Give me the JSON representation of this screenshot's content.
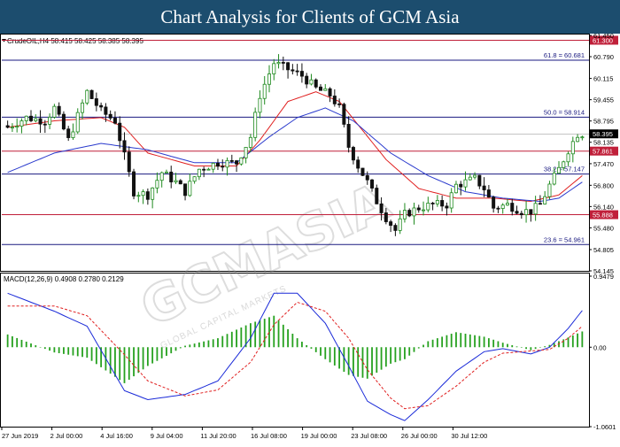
{
  "header": {
    "title": "Chart Analysis for Clients of GCM Asia"
  },
  "chart_data": {
    "type": "candlestick",
    "symbol_info": "CrudeOIL,H4  58.415 58.425 58.385 58.395",
    "watermark": "GCMASIA",
    "watermark_sub": "GLOBAL CAPITAL MARKETS",
    "ylim": [
      54.145,
      61.45
    ],
    "y_ticks": [
      "61.450",
      "60.790",
      "60.115",
      "59.455",
      "58.795",
      "58.135",
      "57.470",
      "56.800",
      "56.140",
      "55.480",
      "54.805",
      "54.145"
    ],
    "x_ticks": [
      "27 Jun 2019",
      "2 Jul 00:00",
      "4 Jul 16:00",
      "9 Jul 04:00",
      "11 Jul 20:00",
      "16 Jul 08:00",
      "19 Jul 00:00",
      "23 Jul 08:00",
      "26 Jul 00:00",
      "30 Jul 12:00"
    ],
    "current_price": {
      "value": 58.395,
      "label": "58.395",
      "color": "#000000"
    },
    "horizontal_lines": [
      {
        "value": 61.3,
        "label": "61.300",
        "color": "#c0203a",
        "tag": ""
      },
      {
        "value": 60.681,
        "label": "",
        "color": "#1a1a80",
        "tag": "61.8 = 60.681"
      },
      {
        "value": 58.914,
        "label": "",
        "color": "#1a1a80",
        "tag": "50.0 = 58.914"
      },
      {
        "value": 57.861,
        "label": "57.861",
        "color": "#c0203a",
        "tag": ""
      },
      {
        "value": 57.147,
        "label": "",
        "color": "#1a1a80",
        "tag": "38.2 = 57.147"
      },
      {
        "value": 55.888,
        "label": "55.888",
        "color": "#c0203a",
        "tag": ""
      },
      {
        "value": 54.961,
        "label": "",
        "color": "#1a1a80",
        "tag": "23.6 = 54.961"
      }
    ],
    "anchors": [
      [
        0,
        58.6
      ],
      [
        4,
        58.9
      ],
      [
        8,
        58.8
      ],
      [
        10,
        59.2
      ],
      [
        13,
        58.2
      ],
      [
        17,
        59.7
      ],
      [
        20,
        59.1
      ],
      [
        23,
        58.8
      ],
      [
        25,
        57.7
      ],
      [
        27,
        56.6
      ],
      [
        30,
        56.5
      ],
      [
        33,
        57.2
      ],
      [
        36,
        56.9
      ],
      [
        38,
        56.6
      ],
      [
        41,
        57.3
      ],
      [
        45,
        57.5
      ],
      [
        49,
        57.5
      ],
      [
        52,
        58.3
      ],
      [
        54,
        59.6
      ],
      [
        57,
        60.6
      ],
      [
        60,
        60.4
      ],
      [
        63,
        60.2
      ],
      [
        66,
        59.8
      ],
      [
        69,
        59.6
      ],
      [
        71,
        59.2
      ],
      [
        73,
        58.0
      ],
      [
        75,
        57.4
      ],
      [
        77,
        56.9
      ],
      [
        79,
        56.3
      ],
      [
        81,
        55.8
      ],
      [
        83,
        55.4
      ],
      [
        85,
        55.9
      ],
      [
        88,
        56.1
      ],
      [
        91,
        56.2
      ],
      [
        94,
        56.2
      ],
      [
        96,
        56.8
      ],
      [
        98,
        56.9
      ],
      [
        100,
        57.0
      ],
      [
        102,
        56.7
      ],
      [
        104,
        56.1
      ],
      [
        107,
        56.2
      ],
      [
        110,
        56.0
      ],
      [
        112,
        56.0
      ],
      [
        114,
        56.2
      ],
      [
        116,
        56.8
      ],
      [
        118,
        57.3
      ],
      [
        120,
        57.9
      ],
      [
        122,
        58.4
      ],
      [
        123,
        58.4
      ]
    ],
    "sma_red_anchors": [
      [
        0,
        58.6
      ],
      [
        10,
        58.8
      ],
      [
        20,
        58.9
      ],
      [
        25,
        58.6
      ],
      [
        30,
        57.8
      ],
      [
        40,
        57.4
      ],
      [
        49,
        57.4
      ],
      [
        54,
        58.2
      ],
      [
        60,
        59.4
      ],
      [
        66,
        59.7
      ],
      [
        71,
        59.4
      ],
      [
        76,
        58.5
      ],
      [
        81,
        57.6
      ],
      [
        88,
        56.7
      ],
      [
        96,
        56.4
      ],
      [
        104,
        56.4
      ],
      [
        112,
        56.3
      ],
      [
        118,
        56.5
      ],
      [
        123,
        57.1
      ]
    ],
    "sma_blue_anchors": [
      [
        0,
        57.2
      ],
      [
        10,
        57.8
      ],
      [
        20,
        58.1
      ],
      [
        30,
        57.9
      ],
      [
        40,
        57.5
      ],
      [
        49,
        57.5
      ],
      [
        56,
        58.3
      ],
      [
        62,
        58.9
      ],
      [
        68,
        59.2
      ],
      [
        74,
        58.8
      ],
      [
        82,
        57.8
      ],
      [
        90,
        57.1
      ],
      [
        98,
        56.6
      ],
      [
        106,
        56.4
      ],
      [
        114,
        56.3
      ],
      [
        118,
        56.4
      ],
      [
        123,
        56.9
      ]
    ],
    "macd": {
      "label": "MACD(12,26,9) 0.4908 0.2780 0.2129",
      "ylim": [
        -1.0601,
        0.9479
      ],
      "y_ticks": [
        "0.9479",
        "0.00",
        "-1.0601"
      ],
      "macd_anchors": [
        [
          0,
          0.72
        ],
        [
          10,
          0.48
        ],
        [
          17,
          0.28
        ],
        [
          25,
          -0.58
        ],
        [
          30,
          -0.7
        ],
        [
          38,
          -0.63
        ],
        [
          45,
          -0.45
        ],
        [
          52,
          0.12
        ],
        [
          57,
          0.72
        ],
        [
          62,
          0.72
        ],
        [
          68,
          0.32
        ],
        [
          73,
          -0.25
        ],
        [
          77,
          -0.72
        ],
        [
          82,
          -0.9
        ],
        [
          85,
          -0.98
        ],
        [
          90,
          -0.7
        ],
        [
          96,
          -0.32
        ],
        [
          102,
          -0.06
        ],
        [
          106,
          -0.02
        ],
        [
          112,
          -0.09
        ],
        [
          116,
          0.0
        ],
        [
          120,
          0.25
        ],
        [
          123,
          0.49
        ]
      ],
      "signal_anchors": [
        [
          0,
          0.55
        ],
        [
          10,
          0.55
        ],
        [
          17,
          0.42
        ],
        [
          25,
          -0.1
        ],
        [
          30,
          -0.45
        ],
        [
          38,
          -0.65
        ],
        [
          45,
          -0.57
        ],
        [
          52,
          -0.2
        ],
        [
          57,
          0.3
        ],
        [
          62,
          0.6
        ],
        [
          68,
          0.48
        ],
        [
          73,
          0.12
        ],
        [
          77,
          -0.3
        ],
        [
          82,
          -0.68
        ],
        [
          85,
          -0.82
        ],
        [
          90,
          -0.78
        ],
        [
          96,
          -0.52
        ],
        [
          102,
          -0.2
        ],
        [
          106,
          -0.08
        ],
        [
          112,
          -0.05
        ],
        [
          116,
          -0.03
        ],
        [
          120,
          0.12
        ],
        [
          123,
          0.28
        ]
      ]
    },
    "colors": {
      "bull": "#1e8a1e",
      "bear": "#111111",
      "sma_red": "#e02020",
      "sma_blue": "#2a3acd",
      "macd_line": "#1a2ad8",
      "signal_line": "#e02020",
      "histogram": "#26a11f",
      "axis": "#000000"
    }
  }
}
